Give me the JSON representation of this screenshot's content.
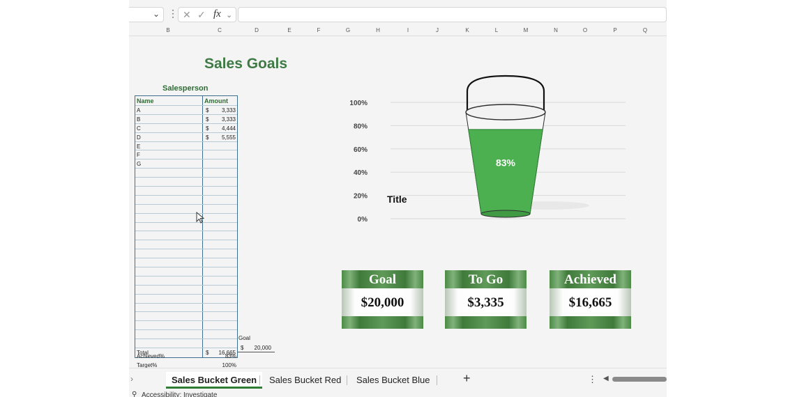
{
  "formula_bar": {
    "fx_label": "fx",
    "cancel_glyph": "✕",
    "enter_glyph": "✓"
  },
  "columns": [
    "B",
    "C",
    "D",
    "E",
    "F",
    "G",
    "H",
    "I",
    "J",
    "K",
    "L",
    "M",
    "N",
    "O",
    "P",
    "Q"
  ],
  "title": "Sales Goals",
  "table": {
    "group_label": "Salesperson",
    "headers": [
      "Name",
      "Amount"
    ],
    "currency": "$",
    "rows": [
      {
        "name": "A",
        "amount": "3,333"
      },
      {
        "name": "B",
        "amount": "3,333"
      },
      {
        "name": "C",
        "amount": "4,444"
      },
      {
        "name": "D",
        "amount": "5,555"
      },
      {
        "name": "E",
        "amount": ""
      },
      {
        "name": "F",
        "amount": ""
      },
      {
        "name": "G",
        "amount": ""
      }
    ],
    "blank_rows": 20,
    "total_label": "Total",
    "total_amount": "16,665",
    "goal_label": "Goal",
    "goal_amount": "20,000",
    "achieved_pct_label": "Achieved%",
    "achieved_pct_value": "83%",
    "target_pct_label": "Target%",
    "target_pct_value": "100%"
  },
  "chart_data": {
    "type": "bar",
    "title": "Title",
    "categories": [
      ""
    ],
    "values": [
      0.83
    ],
    "data_label": "83%",
    "ylim": [
      0,
      1
    ],
    "yticks": [
      "0%",
      "20%",
      "40%",
      "60%",
      "80%",
      "100%"
    ],
    "grid": true,
    "fill_color": "#4caf50"
  },
  "cards": [
    {
      "label": "Goal",
      "value": "$20,000"
    },
    {
      "label": "To Go",
      "value": "$3,335"
    },
    {
      "label": "Achieved",
      "value": "$16,665"
    }
  ],
  "sheet_tabs": {
    "tabs": [
      "Sales Bucket Green",
      "Sales Bucket Red",
      "Sales Bucket Blue"
    ],
    "active": "Sales Bucket Green",
    "add_glyph": "+",
    "more_glyph": "⋮"
  },
  "status": {
    "accessibility": "Accessibility: Investigate"
  },
  "colors": {
    "accent": "#2e7d32",
    "title": "#3f7a45",
    "table_border": "#3d6e8d"
  }
}
